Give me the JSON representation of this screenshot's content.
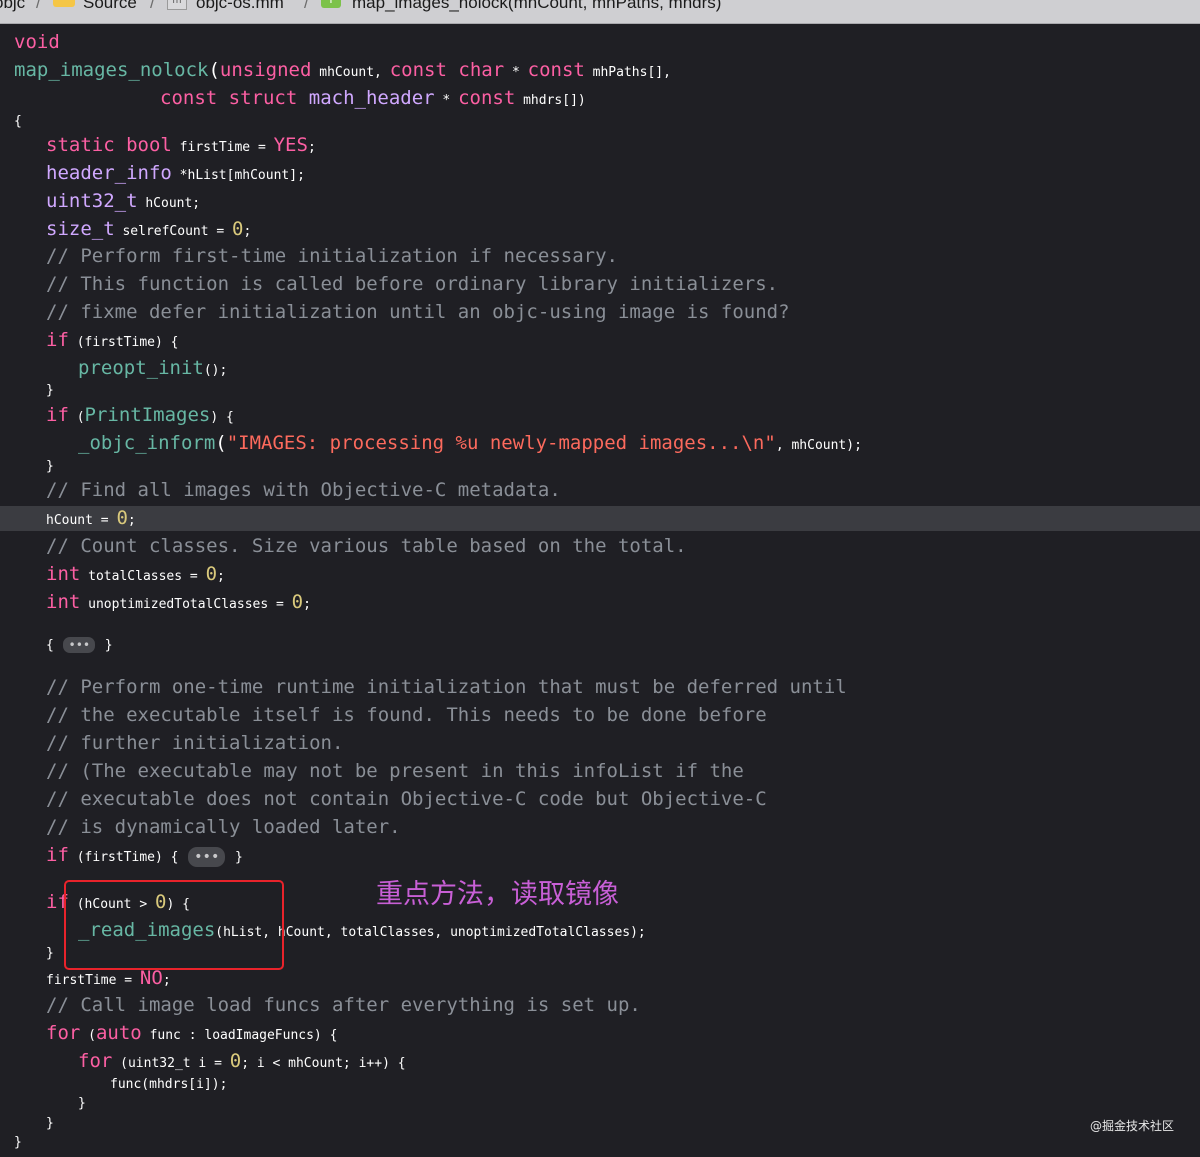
{
  "breadcrumb": {
    "items": [
      "objc",
      "Source",
      "objc-os.mm",
      "map_images_nolock(mhCount, mhPaths, mhdrs)"
    ],
    "separator": "/"
  },
  "code": {
    "l1": {
      "a": "void"
    },
    "l2": {
      "a": "map_images_nolock",
      "b": "(",
      "c": "unsigned",
      "d": " mhCount, ",
      "e": "const",
      "f": " ",
      "g": "char",
      "h": " * ",
      "i": "const",
      "j": " mhPaths[],"
    },
    "l3": {
      "a": "const",
      "b": " ",
      "c": "struct",
      "d": " ",
      "e": "mach_header",
      "f": " * ",
      "g": "const",
      "h": " mhdrs[])"
    },
    "l4": {
      "a": "{"
    },
    "l5": {
      "a": "static",
      "b": " ",
      "c": "bool",
      "d": " firstTime = ",
      "e": "YES",
      "f": ";"
    },
    "l6": {
      "a": "header_info",
      "b": " *hList[mhCount];"
    },
    "l7": {
      "a": "uint32_t",
      "b": " hCount;"
    },
    "l8": {
      "a": "size_t",
      "b": " selrefCount = ",
      "c": "0",
      "d": ";"
    },
    "l9": "// Perform first-time initialization if necessary.",
    "l10": "// This function is called before ordinary library initializers.",
    "l11": "// fixme defer initialization until an objc-using image is found?",
    "l12": {
      "a": "if",
      "b": " (firstTime) {"
    },
    "l13": {
      "a": "preopt_init",
      "b": "();"
    },
    "l14": {
      "a": "}"
    },
    "l15": {
      "a": "if",
      "b": " (",
      "c": "PrintImages",
      "d": ") {"
    },
    "l16": {
      "a": "_objc_inform",
      "b": "(",
      "c": "\"IMAGES: processing %u newly-mapped images...\\n\"",
      "d": ", mhCount);"
    },
    "l17": {
      "a": "}"
    },
    "l18": "// Find all images with Objective-C metadata.",
    "l19": {
      "a": "hCount = ",
      "b": "0",
      "c": ";"
    },
    "l20": "// Count classes. Size various table based on the total.",
    "l21": {
      "a": "int",
      "b": " totalClasses = ",
      "c": "0",
      "d": ";"
    },
    "l22": {
      "a": "int",
      "b": " unoptimizedTotalClasses = ",
      "c": "0",
      "d": ";"
    },
    "l23": {
      "a": "{",
      "fold": "•••",
      "b": "}"
    },
    "l24": "// Perform one-time runtime initialization that must be deferred until",
    "l25": "// the executable itself is found. This needs to be done before",
    "l26": "// further initialization.",
    "l27": "// (The executable may not be present in this infoList if the",
    "l28": "// executable does not contain Objective-C code but Objective-C",
    "l29": "// is dynamically loaded later.",
    "l30": {
      "a": "if",
      "b": " (firstTime) {",
      "fold": "•••",
      "c": "}"
    },
    "l31": {
      "a": "if",
      "b": " (hCount > ",
      "c": "0",
      "d": ") {"
    },
    "l32": {
      "a": "_read_images",
      "b": "(hList, hCount, totalClasses, unoptimizedTotalClasses);"
    },
    "l33": {
      "a": "}"
    },
    "l34": {
      "a": "firstTime = ",
      "b": "NO",
      "c": ";"
    },
    "l35": "// Call image load funcs after everything is set up.",
    "l36": {
      "a": "for",
      "b": " (",
      "c": "auto",
      "d": " func : loadImageFuncs) {"
    },
    "l37": {
      "a": "for",
      "b": " (uint32_t i = ",
      "c": "0",
      "d": "; i < mhCount; i++) {"
    },
    "l38": {
      "a": "func(mhdrs[i]);"
    },
    "l39": {
      "a": "}"
    },
    "l40": {
      "a": "}"
    },
    "l41": {
      "a": "}"
    }
  },
  "annotation": {
    "text": "重点方法，读取镜像",
    "color": "#c85fd6",
    "box_color": "#e8232b"
  },
  "watermark": "@掘金技术社区",
  "colors": {
    "background": "#1f1f24",
    "keyword": "#fc5fa3",
    "type": "#d0a8ff",
    "function": "#67b7a4",
    "comment": "#8a8f97",
    "string": "#fc6a5d",
    "number": "#d9c97c",
    "highlight_line": "#3b3c41"
  },
  "icons": {
    "folder": "folder-icon",
    "file": "objc-file-icon",
    "function": "function-icon"
  }
}
